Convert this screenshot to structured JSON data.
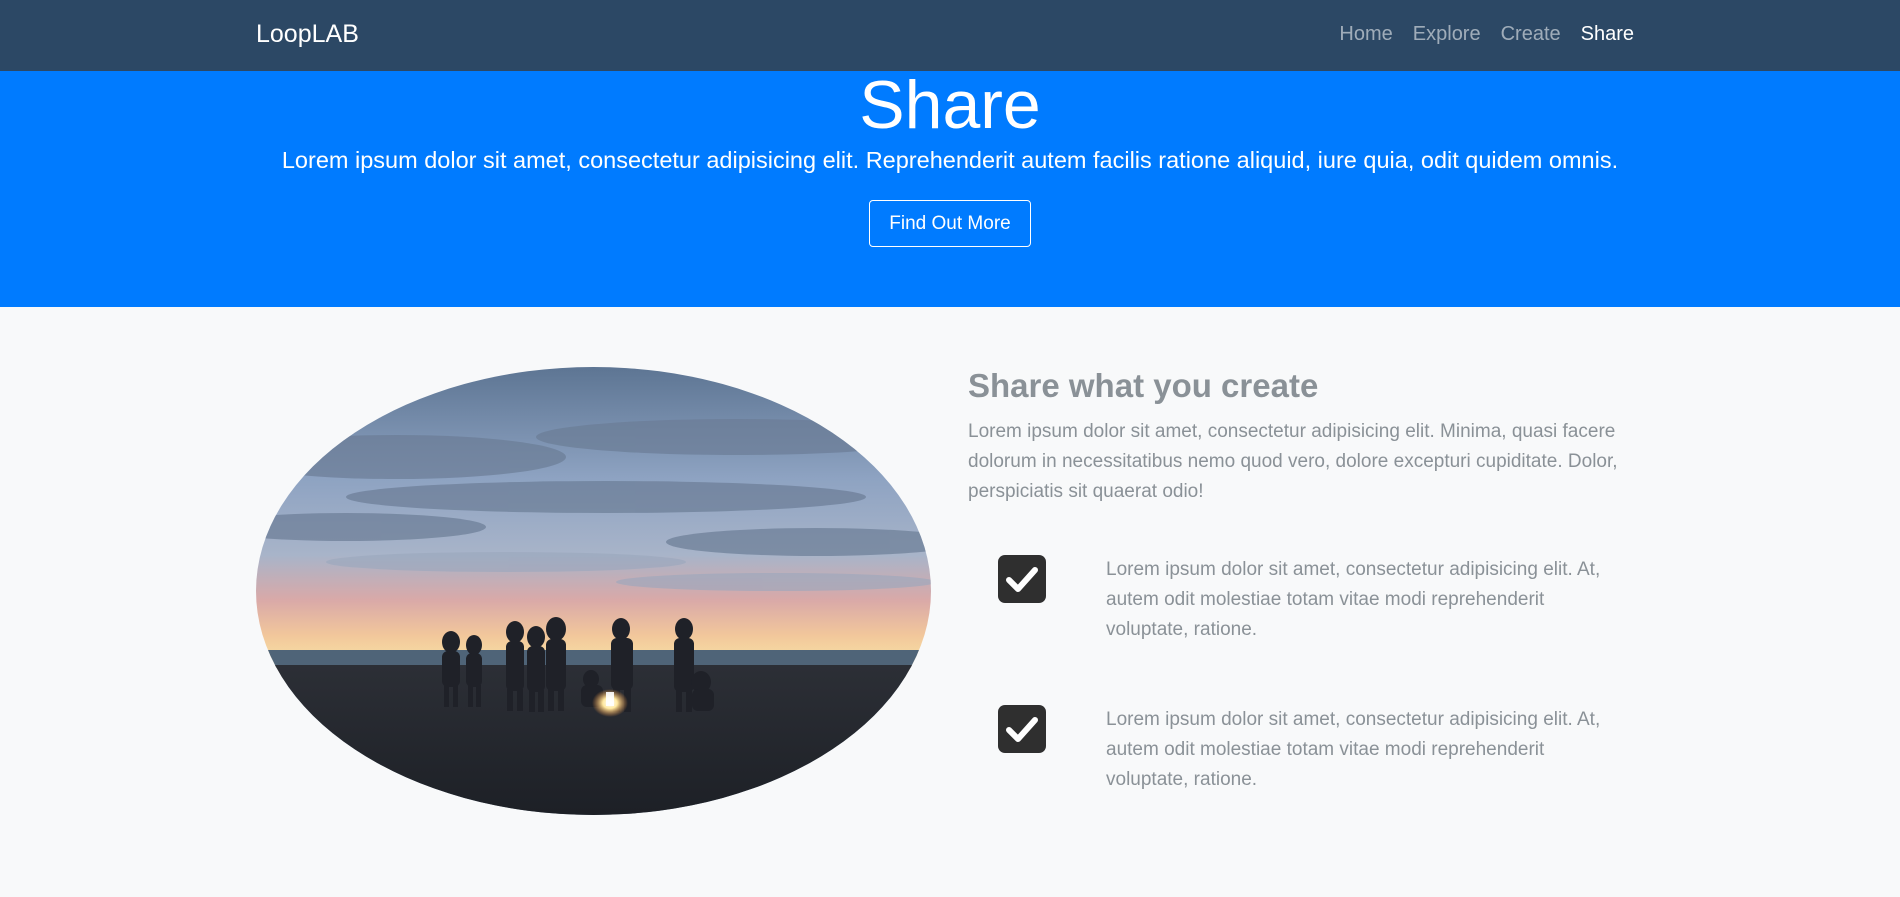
{
  "navbar": {
    "brand": "LoopLAB",
    "links": [
      {
        "label": "Home",
        "active": false
      },
      {
        "label": "Explore",
        "active": false
      },
      {
        "label": "Create",
        "active": false
      },
      {
        "label": "Share",
        "active": true
      }
    ]
  },
  "hero": {
    "title": "Share",
    "subtitle": "Lorem ipsum dolor sit amet, consectetur adipisicing elit. Reprehenderit autem facilis ratione aliquid, iure quia, odit quidem omnis.",
    "button_label": "Find Out More",
    "background_color": "#007bff"
  },
  "section": {
    "title": "Share what you create",
    "text": "Lorem ipsum dolor sit amet, consectetur adipisicing elit. Minima, quasi facere dolorum in necessitatibus nemo quod vero, dolore excepturi cupiditate. Dolor, perspiciatis sit quaerat odio!",
    "features": [
      {
        "icon": "checkbox-checked-icon",
        "text": "Lorem ipsum dolor sit amet, consectetur adipisicing elit. At, autem odit molestiae totam vitae modi reprehenderit voluptate, ratione."
      },
      {
        "icon": "checkbox-checked-icon",
        "text": "Lorem ipsum dolor sit amet, consectetur adipisicing elit. At, autem odit molestiae totam vitae modi reprehenderit voluptate, ratione."
      }
    ]
  },
  "colors": {
    "navbar_bg": "#2c4865",
    "accent": "#007bff",
    "text_muted": "#8a9197"
  }
}
